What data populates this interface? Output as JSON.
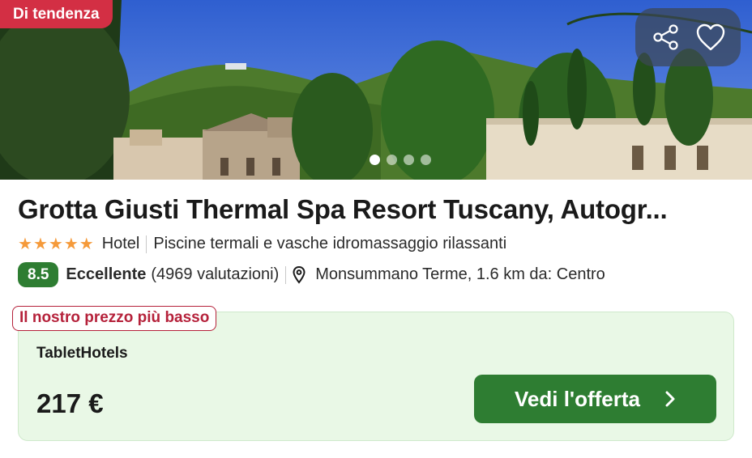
{
  "badge": {
    "label": "Di tendenza"
  },
  "actions": {
    "share_icon": "share-icon",
    "favorite_icon": "heart-icon"
  },
  "carousel": {
    "count": 4,
    "active_index": 0
  },
  "hotel": {
    "name": "Grotta Giusti Thermal Spa Resort Tuscany, Autogr...",
    "stars": 5,
    "type": "Hotel",
    "highlight": "Piscine termali e vasche idromassaggio rilassanti",
    "score": "8.5",
    "rating_label": "Eccellente",
    "reviews": "(4969 valutazioni)",
    "location": "Monsummano Terme, 1.6 km da: Centro"
  },
  "offer": {
    "tag": "Il nostro prezzo più basso",
    "provider": "TabletHotels",
    "price": "217 €",
    "cta_label": "Vedi l'offerta"
  },
  "colors": {
    "badge": "#d32f44",
    "score": "#2e7d32",
    "cta": "#2e7d32",
    "offer_bg": "#e9f8e6",
    "tag": "#b5213a",
    "stars": "#f59a3a"
  }
}
